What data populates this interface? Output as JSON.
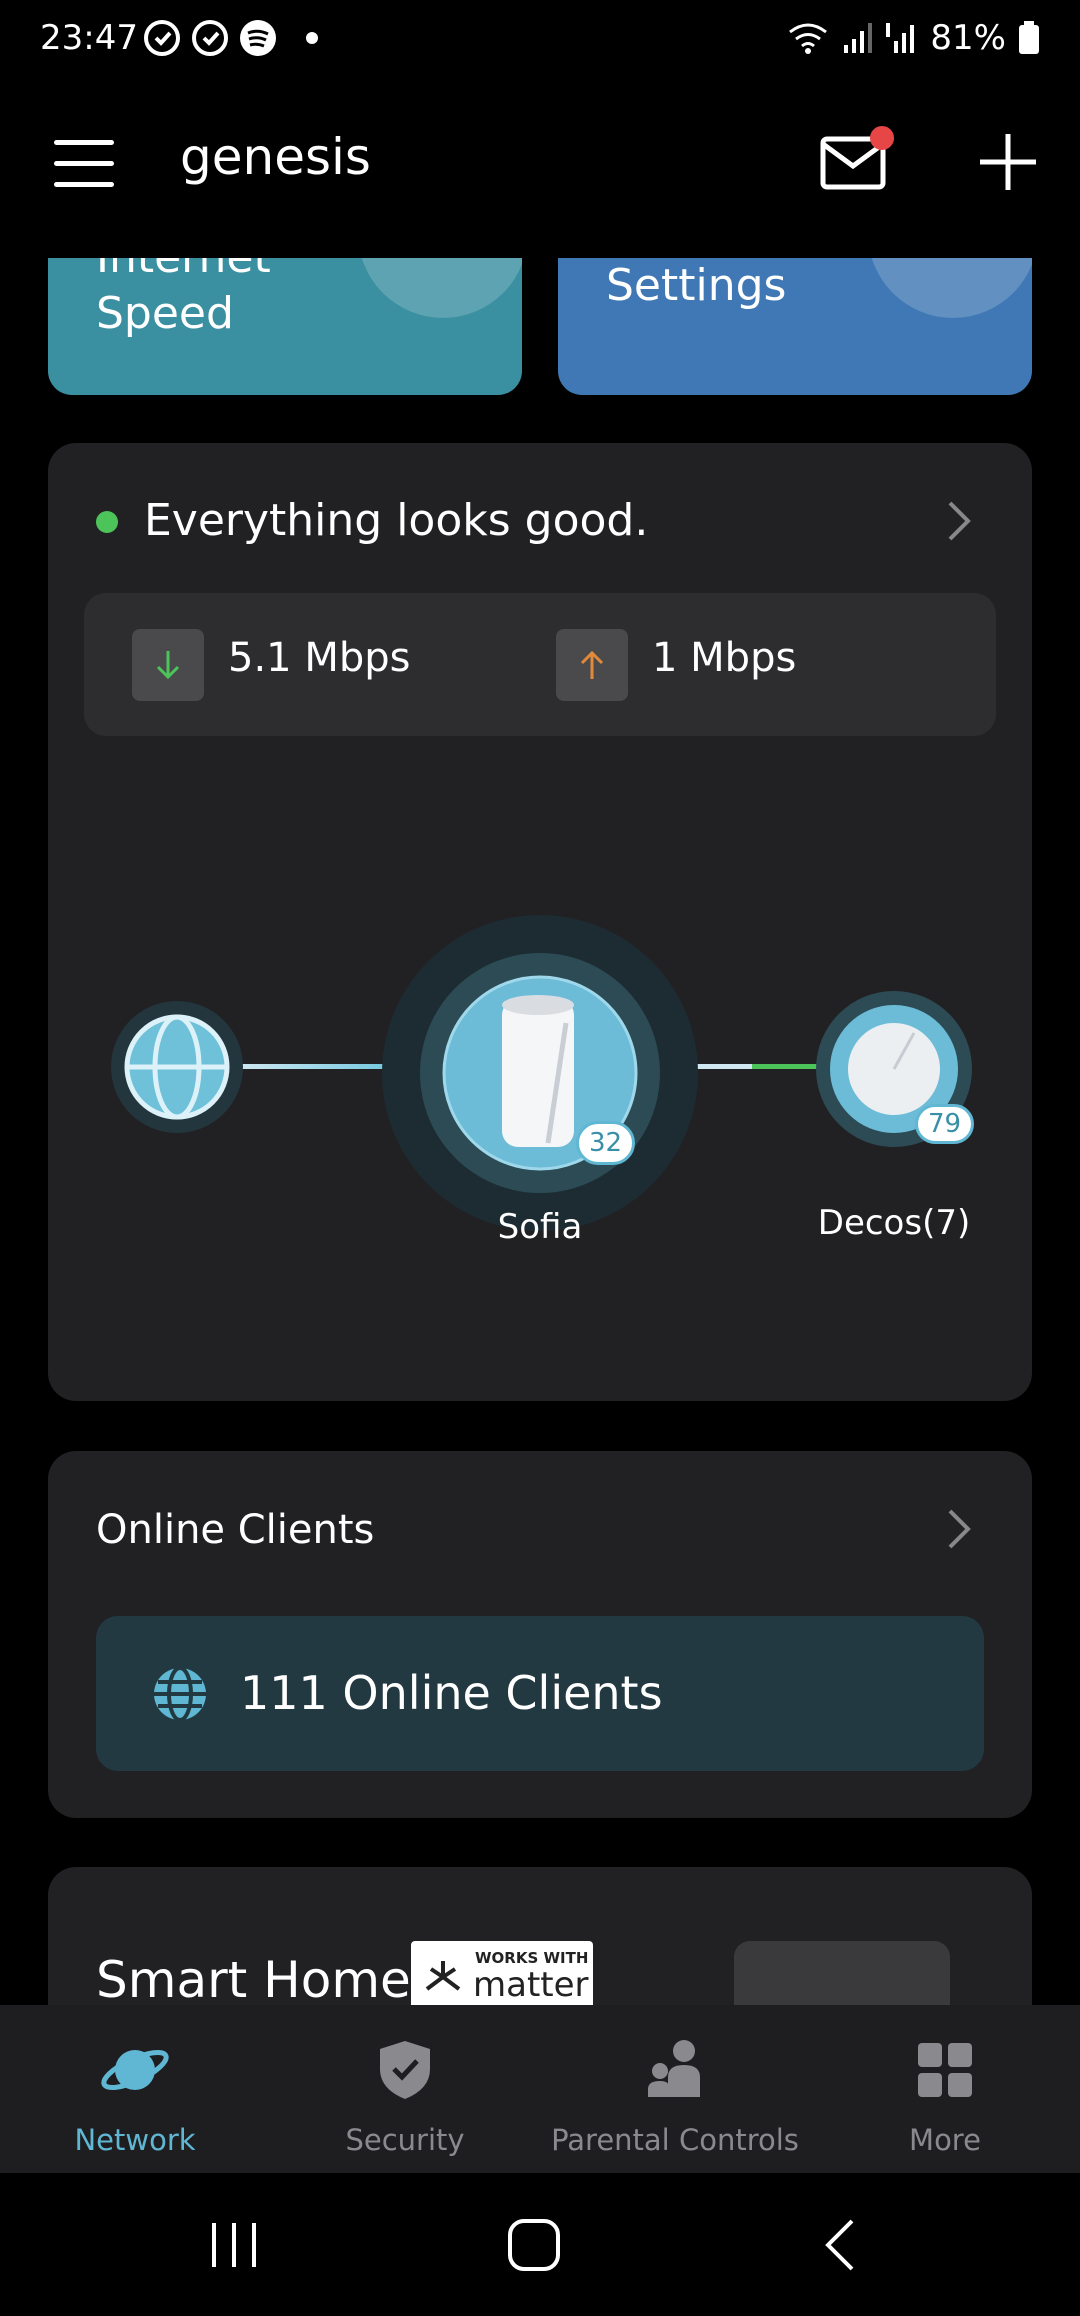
{
  "status_bar": {
    "time": "23:47",
    "battery": "81%"
  },
  "header": {
    "network_name": "genesis"
  },
  "tiles": {
    "speed_label": "Internet\nSpeed",
    "settings_label": "Settings"
  },
  "network_status": {
    "message": "Everything looks good.",
    "download": "5.1 Mbps",
    "upload": "1 Mbps",
    "main_node": {
      "name": "Sofia",
      "clients": "32"
    },
    "satellite": {
      "name": "Decos(7)",
      "clients": "79"
    }
  },
  "online_clients": {
    "title": "Online Clients",
    "summary": "111 Online Clients"
  },
  "smart_home": {
    "title": "Smart Home",
    "badge_small": "WORKS WITH",
    "badge_big": "matter"
  },
  "bottom_nav": {
    "items": [
      {
        "label": "Network",
        "icon": "planet-icon",
        "active": true
      },
      {
        "label": "Security",
        "icon": "shield-check-icon",
        "active": false
      },
      {
        "label": "Parental Controls",
        "icon": "family-icon",
        "active": false
      },
      {
        "label": "More",
        "icon": "grid-icon",
        "active": false
      }
    ]
  },
  "colors": {
    "accent": "#5fb7d3",
    "status_good": "#4cc45a",
    "notification": "#e64646"
  }
}
